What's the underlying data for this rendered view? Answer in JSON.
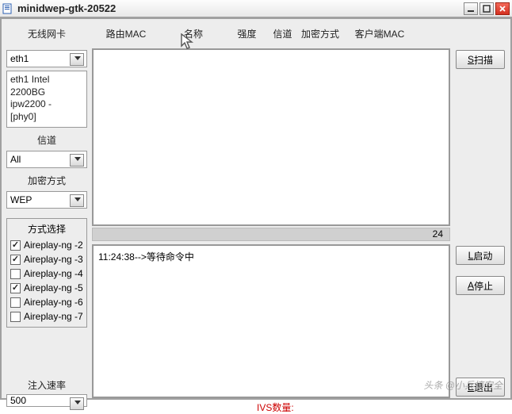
{
  "window": {
    "title": "minidwep-gtk-20522"
  },
  "headers": {
    "nic": "无线网卡",
    "mac": "路由MAC",
    "name": "名称",
    "strength": "强度",
    "channel": "信道",
    "encrypt": "加密方式",
    "client_mac": "客户端MAC"
  },
  "nic": {
    "selected": "eth1",
    "detail_line1": "eth1 Intel",
    "detail_line2": "2200BG",
    "detail_line3": "ipw2200 -",
    "detail_line4": "[phy0]"
  },
  "channel": {
    "label": "信道",
    "selected": "All"
  },
  "encrypt": {
    "label": "加密方式",
    "selected": "WEP"
  },
  "method": {
    "label": "方式选择",
    "items": [
      {
        "label": "Aireplay-ng -2",
        "checked": true
      },
      {
        "label": "Aireplay-ng -3",
        "checked": true
      },
      {
        "label": "Aireplay-ng -4",
        "checked": false
      },
      {
        "label": "Aireplay-ng -5",
        "checked": true
      },
      {
        "label": "Aireplay-ng -6",
        "checked": false
      },
      {
        "label": "Aireplay-ng -7",
        "checked": false
      }
    ]
  },
  "inject": {
    "label": "注入速率",
    "selected": "500"
  },
  "buttons": {
    "scan_u": "S",
    "scan_t": "扫描",
    "start_u": "L",
    "start_t": "启动",
    "stop_u": "A",
    "stop_t": "停止",
    "exit_u": "E",
    "exit_t": "退出"
  },
  "status": {
    "count": "24"
  },
  "log": {
    "line1": "11:24:38-->等待命令中"
  },
  "footer": {
    "ivs": "IVS数量:"
  },
  "watermark": "头条 @小兵搞安全"
}
